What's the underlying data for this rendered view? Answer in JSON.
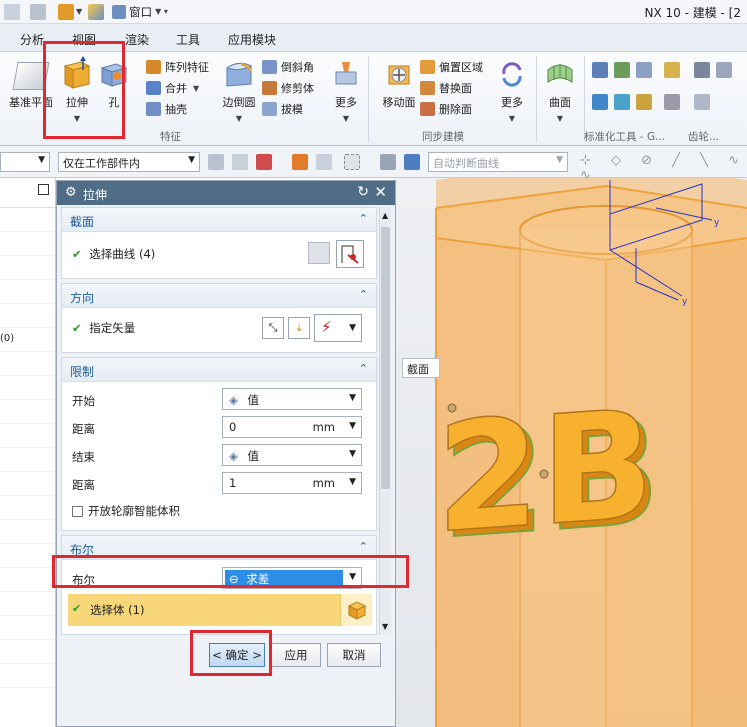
{
  "titlebar": {
    "window_menu": "窗口",
    "app_title": "NX 10 - 建模 - [2"
  },
  "menu": {
    "items": [
      "分析",
      "视图",
      "渲染",
      "工具",
      "应用模块"
    ]
  },
  "ribbon": {
    "datum_plane": "基准平面",
    "extrude": "拉伸",
    "hole": "孔",
    "pattern_feature": "阵列特征",
    "unite": "合并",
    "shell": "抽壳",
    "edge_blend": "边倒圆",
    "chamfer": "倒斜角",
    "trim_body": "修剪体",
    "draft": "拔模",
    "more_feature": "更多",
    "feature_group": "特征",
    "move_face": "移动面",
    "offset_region": "偏置区域",
    "replace_face": "替换面",
    "delete_face": "删除面",
    "more_sync": "更多",
    "sync_group": "同步建模",
    "surface": "曲面",
    "std_tools_group": "标准化工具 - G...",
    "gear_group": "齿轮..."
  },
  "filterbar": {
    "scope_value": "仅在工作部件内",
    "curve_rule": "自动判断曲线"
  },
  "navigator": {
    "row_text": "(0)"
  },
  "dialog": {
    "title": "拉伸",
    "section": {
      "header": "截面",
      "select_curve": "选择曲线 (4)"
    },
    "direction": {
      "header": "方向",
      "specify_vector": "指定矢量"
    },
    "limits": {
      "header": "限制",
      "start_label": "开始",
      "start_value": "值",
      "distance1_label": "距离",
      "distance1_value": "0",
      "distance1_unit": "mm",
      "end_label": "结束",
      "end_value": "值",
      "distance2_label": "距离",
      "distance2_value": "1",
      "distance2_unit": "mm",
      "open_profile": "开放轮廓智能体积"
    },
    "boolean": {
      "header": "布尔",
      "label": "布尔",
      "value": "求差",
      "select_body": "选择体 (1)"
    },
    "buttons": {
      "ok": "< 确定 >",
      "apply": "应用",
      "cancel": "取消"
    }
  },
  "viewport": {
    "section_tooltip": "截面",
    "model_text": "2B"
  },
  "colors": {
    "highlight_red": "#e0282e",
    "dialog_title_bg": "#4f6d86",
    "section_header_text": "#1f5c9b",
    "boolean_selected_bg": "#2e8ee6",
    "select_body_bg": "#f7d77a",
    "model_orange": "#f3a02a"
  }
}
